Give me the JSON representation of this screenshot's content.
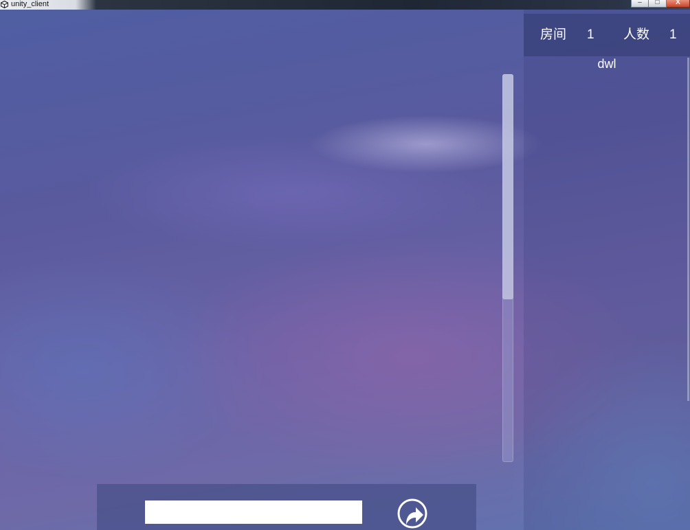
{
  "window": {
    "title": "unity_client",
    "controls": {
      "minimize": "–",
      "maximize": "□",
      "close": "X"
    }
  },
  "room_panel": {
    "room_label": "房间",
    "room_value": "1",
    "count_label": "人数",
    "count_value": "1",
    "players": [
      "dwl"
    ]
  },
  "chat": {
    "scroll_position": 0.0,
    "visible_fraction": 0.58
  },
  "input_bar": {
    "input_value": "",
    "send_icon": "share-arrow-icon"
  },
  "colors": {
    "panel_text": "#ffffff",
    "input_background": "#ffffff",
    "close_button": "#c9452a"
  }
}
